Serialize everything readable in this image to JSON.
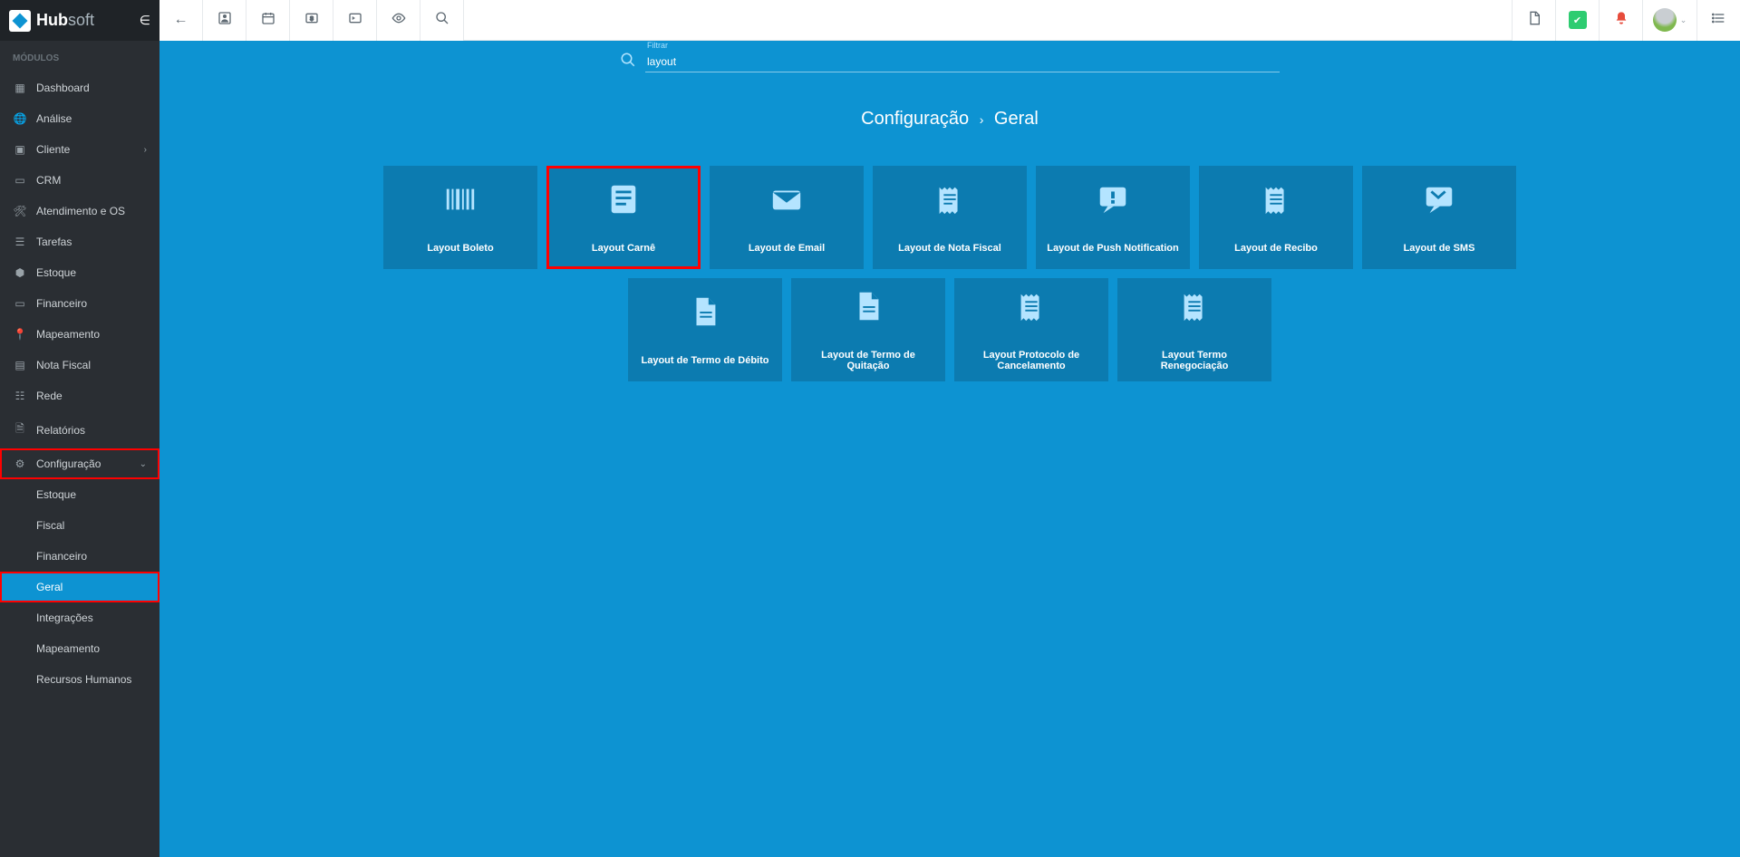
{
  "app": {
    "logo_hub": "Hub",
    "logo_soft": "soft"
  },
  "sidebar": {
    "section_label": "MÓDULOS",
    "items": [
      {
        "label": "Dashboard"
      },
      {
        "label": "Análise"
      },
      {
        "label": "Cliente",
        "has_chevron": true
      },
      {
        "label": "CRM"
      },
      {
        "label": "Atendimento e OS"
      },
      {
        "label": "Tarefas"
      },
      {
        "label": "Estoque"
      },
      {
        "label": "Financeiro"
      },
      {
        "label": "Mapeamento"
      },
      {
        "label": "Nota Fiscal"
      },
      {
        "label": "Rede"
      },
      {
        "label": "Relatórios"
      },
      {
        "label": "Configuração",
        "has_chevron": true,
        "expanded": true,
        "highlighted": true
      }
    ],
    "config_sub": [
      {
        "label": "Estoque"
      },
      {
        "label": "Fiscal"
      },
      {
        "label": "Financeiro"
      },
      {
        "label": "Geral",
        "active": true,
        "highlighted": true
      },
      {
        "label": "Integrações"
      },
      {
        "label": "Mapeamento"
      },
      {
        "label": "Recursos Humanos"
      }
    ]
  },
  "filter": {
    "label": "Filtrar",
    "value": "layout"
  },
  "breadcrumb": {
    "section": "Configuração",
    "page": "Geral"
  },
  "cards_row1": [
    {
      "label": "Layout Boleto",
      "icon": "barcode"
    },
    {
      "label": "Layout Carnê",
      "icon": "doc-lines",
      "highlighted": true
    },
    {
      "label": "Layout de Email",
      "icon": "mail"
    },
    {
      "label": "Layout de Nota Fiscal",
      "icon": "receipt"
    },
    {
      "label": "Layout de Push Notification",
      "icon": "comment-alert"
    },
    {
      "label": "Layout de Recibo",
      "icon": "receipt-lines"
    },
    {
      "label": "Layout de SMS",
      "icon": "sms"
    }
  ],
  "cards_row2": [
    {
      "label": "Layout de Termo de Débito",
      "icon": "file"
    },
    {
      "label": "Layout de Termo de Quitação",
      "icon": "file"
    },
    {
      "label": "Layout Protocolo de Cancelamento",
      "icon": "receipt-lines"
    },
    {
      "label": "Layout Termo Renegociação",
      "icon": "receipt-lines"
    }
  ]
}
